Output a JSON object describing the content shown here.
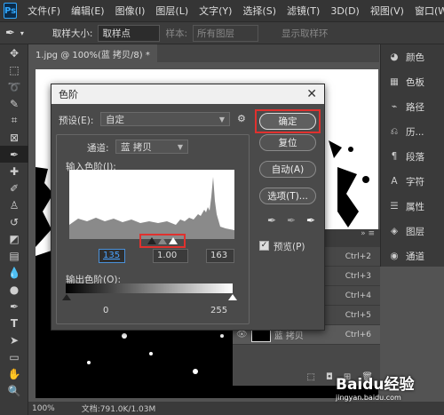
{
  "menubar": {
    "logo": "Ps",
    "items": [
      "文件(F)",
      "编辑(E)",
      "图像(I)",
      "图层(L)",
      "文字(Y)",
      "选择(S)",
      "滤镜(T)",
      "3D(D)",
      "视图(V)",
      "窗口(W)"
    ]
  },
  "options_bar": {
    "sample_size_label": "取样大小:",
    "sample_size_value": "取样点",
    "sample_label": "样本:",
    "sample_value": "所有图层",
    "show_ring": "显示取样环"
  },
  "document_tab": "1.jpg @ 100%(蓝 拷贝/8) *",
  "right_panel": {
    "items": [
      {
        "icon": "palette-icon",
        "label": "颜色"
      },
      {
        "icon": "swatches-icon",
        "label": "色板"
      },
      {
        "icon": "paths-icon",
        "label": "路径"
      },
      {
        "icon": "history-icon",
        "label": "历..."
      },
      {
        "icon": "paragraph-icon",
        "label": "段落"
      },
      {
        "icon": "character-icon",
        "label": "字符"
      },
      {
        "icon": "properties-icon",
        "label": "属性"
      },
      {
        "icon": "layers-icon",
        "label": "图层"
      },
      {
        "icon": "channels-icon",
        "label": "通道"
      }
    ]
  },
  "layers_panel": {
    "shortcuts": [
      "Ctrl+2",
      "Ctrl+3",
      "Ctrl+4",
      "Ctrl+5",
      "Ctrl+6"
    ],
    "active_layer": "蓝 拷贝"
  },
  "statusbar": {
    "zoom": "100%",
    "doc_info": "文档:791.0K/1.03M"
  },
  "levels_dialog": {
    "title": "色阶",
    "preset_label": "预设(E):",
    "preset_value": "自定",
    "channel_label": "通道:",
    "channel_value": "蓝 拷贝",
    "input_levels_label": "输入色阶(I):",
    "input_black": "135",
    "input_gamma": "1.00",
    "input_white": "163",
    "output_levels_label": "输出色阶(O):",
    "output_black": "0",
    "output_white": "255",
    "buttons": {
      "ok": "确定",
      "reset": "复位",
      "auto": "自动(A)",
      "options": "选项(T)..."
    },
    "preview_label": "预览(P)",
    "preview_checked": true
  },
  "watermark": "Baidu经验",
  "watermark_sub": "jingyan.baidu.com"
}
